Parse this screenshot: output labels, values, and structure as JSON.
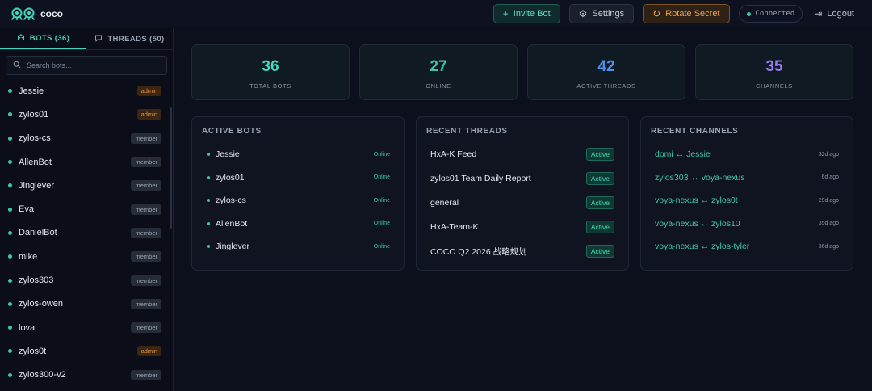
{
  "app": {
    "name": "coco"
  },
  "header": {
    "invite_label": "Invite Bot",
    "settings_label": "Settings",
    "rotate_label": "Rotate Secret",
    "status": "Connected",
    "logout_label": "Logout"
  },
  "colors": {
    "accent": "#43d8bd",
    "admin": "#e39543",
    "rotate": "#f2a54a"
  },
  "sidebar": {
    "tabs": [
      {
        "label": "BOTS (36)",
        "icon": "bot-icon"
      },
      {
        "label": "THREADS (50)",
        "icon": "message-icon"
      }
    ],
    "search_placeholder": "Search bots...",
    "bots": [
      {
        "name": "Jessie",
        "role": "admin"
      },
      {
        "name": "zylos01",
        "role": "admin"
      },
      {
        "name": "zylos-cs",
        "role": "member"
      },
      {
        "name": "AllenBot",
        "role": "member"
      },
      {
        "name": "Jinglever",
        "role": "member"
      },
      {
        "name": "Eva",
        "role": "member"
      },
      {
        "name": "DanielBot",
        "role": "member"
      },
      {
        "name": "mike",
        "role": "member"
      },
      {
        "name": "zylos303",
        "role": "member"
      },
      {
        "name": "zylos-owen",
        "role": "member"
      },
      {
        "name": "lova",
        "role": "member"
      },
      {
        "name": "zylos0t",
        "role": "admin"
      },
      {
        "name": "zylos300-v2",
        "role": "member"
      }
    ]
  },
  "stats": [
    {
      "value": "36",
      "label": "TOTAL BOTS",
      "color": "#43d8bd"
    },
    {
      "value": "27",
      "label": "ONLINE",
      "color": "#3cc6a1"
    },
    {
      "value": "42",
      "label": "ACTIVE THREADS",
      "color": "#4f8fe8"
    },
    {
      "value": "35",
      "label": "CHANNELS",
      "color": "#9a7bf0"
    }
  ],
  "active_bots": {
    "title": "ACTIVE BOTS",
    "items": [
      {
        "name": "Jessie",
        "status": "Online"
      },
      {
        "name": "zylos01",
        "status": "Online"
      },
      {
        "name": "zylos-cs",
        "status": "Online"
      },
      {
        "name": "AllenBot",
        "status": "Online"
      },
      {
        "name": "Jinglever",
        "status": "Online"
      }
    ]
  },
  "recent_threads": {
    "title": "RECENT THREADS",
    "items": [
      {
        "name": "HxA-K Feed",
        "status": "Active"
      },
      {
        "name": "zylos01 Team Daily Report",
        "status": "Active"
      },
      {
        "name": "general",
        "status": "Active"
      },
      {
        "name": "HxA-Team-K",
        "status": "Active"
      },
      {
        "name": "COCO Q2 2026 战略规划",
        "status": "Active"
      }
    ]
  },
  "recent_channels": {
    "title": "RECENT CHANNELS",
    "items": [
      {
        "name": "domi ↔ Jessie",
        "ago": "32d ago"
      },
      {
        "name": "zylos303 ↔ voya-nexus",
        "ago": "6d ago"
      },
      {
        "name": "voya-nexus ↔ zylos0t",
        "ago": "29d ago"
      },
      {
        "name": "voya-nexus ↔ zylos10",
        "ago": "35d ago"
      },
      {
        "name": "voya-nexus ↔ zylos-tyler",
        "ago": "36d ago"
      }
    ]
  }
}
